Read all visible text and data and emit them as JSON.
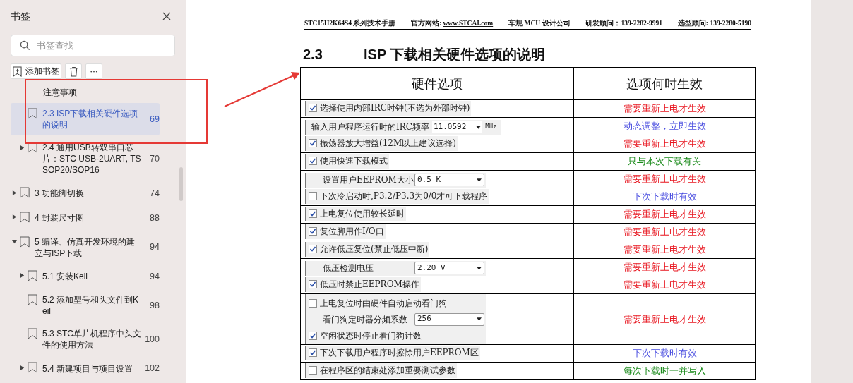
{
  "sidebar": {
    "title": "书签",
    "search": {
      "placeholder": "书签查找"
    },
    "toolbar": {
      "add_label": "添加书签"
    },
    "bookmarks": {
      "continued_children": [
        {
          "label": "注意事项",
          "selected": false,
          "clipped": true
        },
        {
          "label": "2.3  ISP下载相关硬件选项的说明",
          "page": "69",
          "selected": true
        },
        {
          "label": "2.4  通用USB转双串口芯片：STC USB-2UART, TSSOP20/SOP16",
          "page": "70",
          "selected": false,
          "expanded": false
        }
      ],
      "items": [
        {
          "label": "3 功能脚切换",
          "page": "74",
          "selected": false,
          "expanded": false
        },
        {
          "label": "4  封装尺寸图",
          "page": "88",
          "selected": false,
          "expanded": false
        },
        {
          "label": "5  编译、仿真开发环境的建立与ISP下载",
          "page": "94",
          "selected": false,
          "expanded": true,
          "children": [
            {
              "label": "5.1 安装Keil",
              "page": "94",
              "selected": false,
              "expanded": false
            },
            {
              "label": "5.2  添加型号和头文件到Keil",
              "page": "98",
              "selected": false
            },
            {
              "label": "5.3  STC单片机程序中头文件的使用方法",
              "page": "100",
              "selected": false
            },
            {
              "label": "5.4  新建项目与项目设置",
              "page": "102",
              "selected": false,
              "expanded": false
            }
          ]
        }
      ]
    }
  },
  "document": {
    "header": [
      {
        "text": "STC15H2K64S4 系列技术手册"
      },
      {
        "text": "官方网站:",
        "link": "www.STCAI.com"
      },
      {
        "text": "车规 MCU 设计公司"
      },
      {
        "text": "研发顾问：139-2282-9991"
      },
      {
        "text": "选型顾问: 139-2280-5190"
      }
    ],
    "section_number": "2.3",
    "section_title": "ISP 下载相关硬件选项的说明",
    "table": {
      "columns": [
        "硬件选项",
        "选项何时生效"
      ],
      "rows": [
        {
          "option": {
            "kind": "checkbox",
            "label": "选择使用内部IRC时钟(不选为外部时钟)",
            "checked": true
          },
          "effect": {
            "text": "需要重新上电才生效",
            "color": "#e8141e"
          }
        },
        {
          "option": {
            "kind": "input",
            "label": "输入用户程序运行时的IRC频率",
            "value": "11.0592",
            "unit": "MHz"
          },
          "effect": {
            "text": "动态调整，立即生效",
            "color": "#4a4ee0"
          }
        },
        {
          "option": {
            "kind": "checkbox",
            "label": "振荡器放大增益(12M以上建议选择)",
            "checked": true
          },
          "effect": {
            "text": "需要重新上电才生效",
            "color": "#e8141e"
          }
        },
        {
          "option": {
            "kind": "checkbox",
            "label": "使用快速下载模式",
            "checked": true
          },
          "effect": {
            "text": "只与本次下载有关",
            "color": "#1a8a1a"
          }
        },
        {
          "option": {
            "kind": "select",
            "label": "设置用户EEPROM大小",
            "value": "0.5 K"
          },
          "effect": {
            "text": "需要重新上电才生效",
            "color": "#e8141e"
          }
        },
        {
          "option": {
            "kind": "checkbox",
            "label": "下次冷启动时,P3.2/P3.3为0/0才可下载程序",
            "checked": false
          },
          "effect": {
            "text": "下次下载时有效",
            "color": "#4a4ee0"
          }
        },
        {
          "option": {
            "kind": "checkbox",
            "label": "上电复位使用较长延时",
            "checked": true
          },
          "effect": {
            "text": "需要重新上电才生效",
            "color": "#e8141e"
          }
        },
        {
          "option": {
            "kind": "checkbox",
            "label": "复位脚用作I/O口",
            "checked": true
          },
          "effect": {
            "text": "需要重新上电才生效",
            "color": "#e8141e"
          }
        },
        {
          "option": {
            "kind": "checkbox",
            "label": "允许低压复位(禁止低压中断)",
            "checked": true
          },
          "effect": {
            "text": "需要重新上电才生效",
            "color": "#e8141e"
          }
        },
        {
          "option": {
            "kind": "select",
            "label": "低压检测电压",
            "value": "2.20 V"
          },
          "effect": {
            "text": "需要重新上电才生效",
            "color": "#e8141e"
          }
        },
        {
          "option": {
            "kind": "checkbox",
            "label": "低压时禁止EEPROM操作",
            "checked": true
          },
          "effect": {
            "text": "需要重新上电才生效",
            "color": "#e8141e"
          }
        },
        {
          "option": {
            "kind": "group",
            "items": [
              {
                "kind": "checkbox",
                "label": "上电复位时由硬件自动启动看门狗",
                "checked": false
              },
              {
                "kind": "select",
                "label": "看门狗定时器分频系数",
                "value": "256"
              },
              {
                "kind": "checkbox",
                "label": "空闲状态时停止看门狗计数",
                "checked": true
              }
            ]
          },
          "effect": {
            "text": "需要重新上电才生效",
            "color": "#e8141e"
          }
        },
        {
          "option": {
            "kind": "checkbox",
            "label": "下次下载用户程序时擦除用户EEPROM区",
            "checked": true
          },
          "effect": {
            "text": "下次下载时有效",
            "color": "#4a4ee0"
          }
        },
        {
          "option": {
            "kind": "checkbox",
            "label": "在程序区的结束处添加重要测试参数",
            "checked": false
          },
          "effect": {
            "text": "每次下载时一并写入",
            "color": "#1a8a1a"
          }
        }
      ]
    }
  }
}
